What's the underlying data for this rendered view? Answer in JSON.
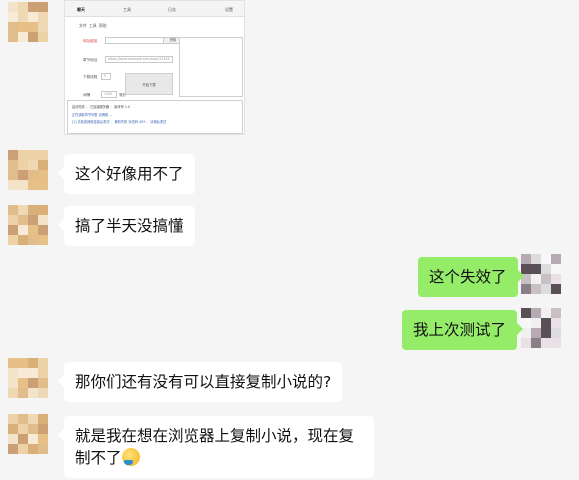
{
  "screenshot": {
    "tabs": [
      "聊天",
      "工具",
      "日志",
      "设置"
    ],
    "menu": [
      "文件",
      "工具",
      "帮助"
    ],
    "url_label": "网址链接",
    "url_value": "",
    "go_button": "获取",
    "chapter_label": "章节地址",
    "chapter_value": "https://www.example.com/book/12345",
    "thread_label": "下载线程",
    "thread_value": "5",
    "spin_label": "间隔",
    "spin_value": "1000",
    "spin_unit": "毫秒",
    "start_button": "开始下载",
    "log_lines": [
      "启动完成 ： 已连接服务器      ：  版本号 1.0",
      "正在读取章节列表 请稍候 ...",
      "[1] 请检查网络连接后重试 ： 解析失败 状态码 403 ： 请稍后重试"
    ]
  },
  "messages": [
    {
      "side": "left",
      "text": "这个好像用不了"
    },
    {
      "side": "left",
      "text": "搞了半天没搞懂"
    },
    {
      "side": "right",
      "text": "这个失效了"
    },
    {
      "side": "right",
      "text": "我上次测试了"
    },
    {
      "side": "left",
      "text": "那你们还有没有可以直接复制小说的?"
    },
    {
      "side": "left",
      "text": "就是我在想在浏览器上复制小说，现在复制不了"
    }
  ],
  "colors": {
    "background": "#f5f5f5",
    "bubble_left": "#ffffff",
    "bubble_right": "#95ec69"
  }
}
